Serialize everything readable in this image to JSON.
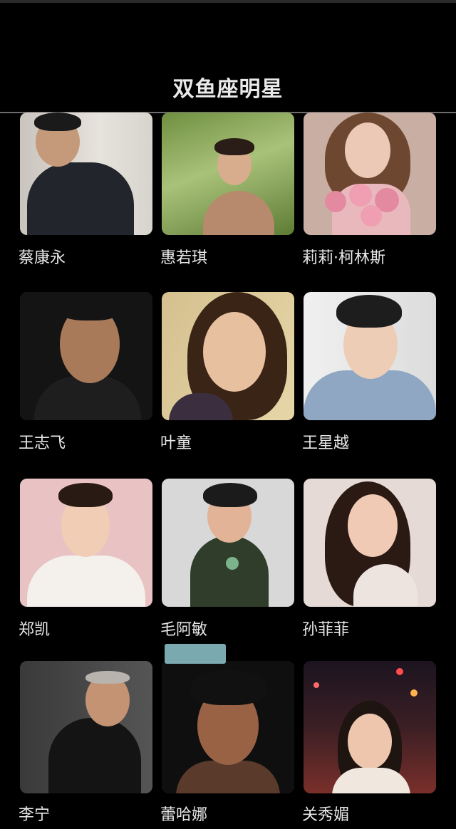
{
  "header": {
    "title": "双鱼座明星"
  },
  "celebrities": [
    {
      "name": "蔡康永"
    },
    {
      "name": "惠若琪"
    },
    {
      "name": "莉莉·柯林斯"
    },
    {
      "name": "王志飞"
    },
    {
      "name": "叶童"
    },
    {
      "name": "王星越"
    },
    {
      "name": "郑凯"
    },
    {
      "name": "毛阿敏"
    },
    {
      "name": "孙菲菲"
    },
    {
      "name": "李宁"
    },
    {
      "name": "蕾哈娜"
    },
    {
      "name": "关秀媚"
    }
  ]
}
